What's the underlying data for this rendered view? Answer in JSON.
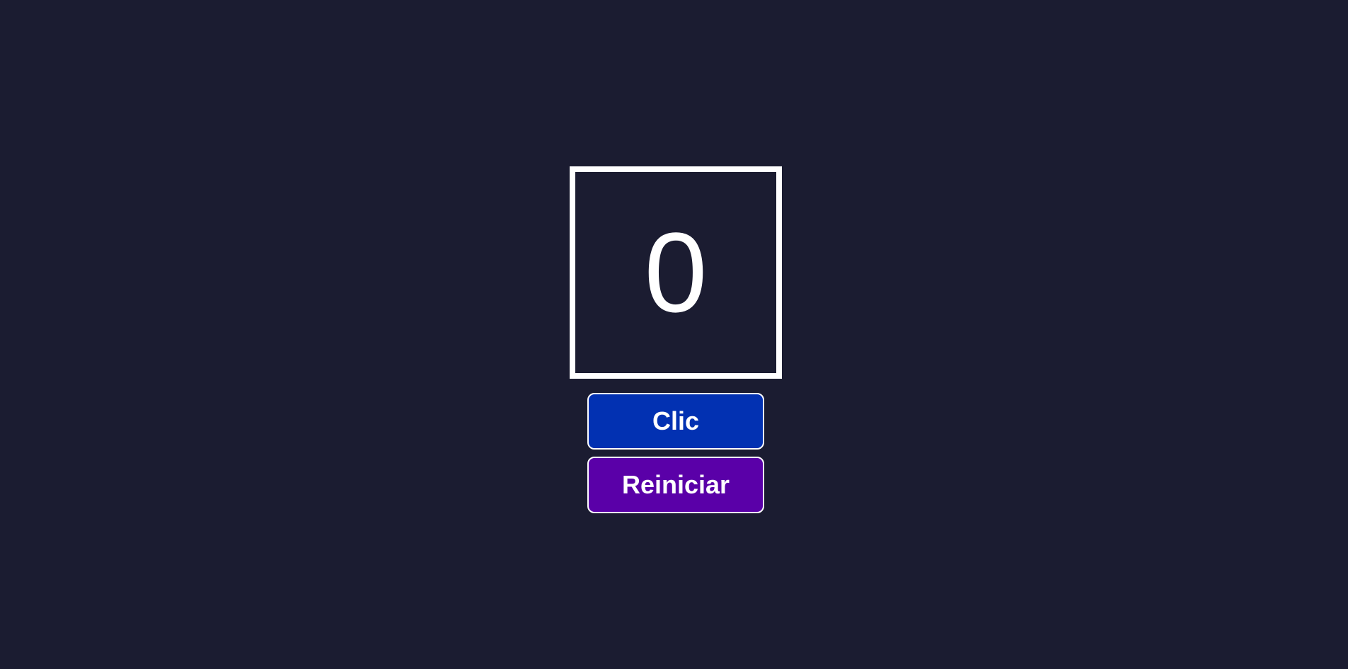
{
  "counter": {
    "value": "0"
  },
  "buttons": {
    "click_label": "Clic",
    "reset_label": "Reiniciar"
  },
  "colors": {
    "background": "#1b1c31",
    "counter_border": "#ffffff",
    "click_button": "#0231b2",
    "reset_button": "#5a00a8",
    "text": "#ffffff"
  }
}
